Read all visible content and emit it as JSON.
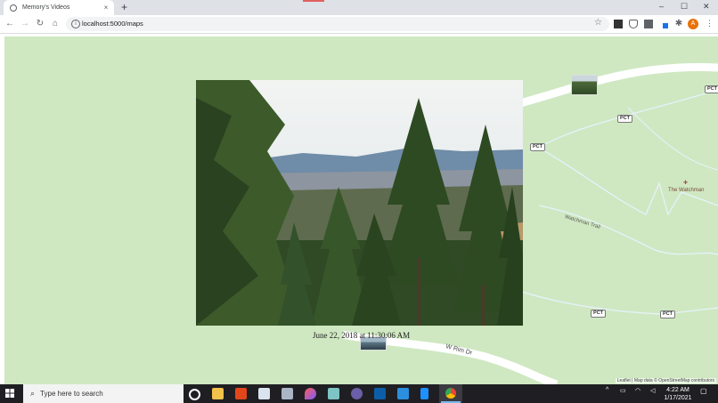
{
  "browser": {
    "tab_title": "Memory's Videos",
    "url": "localhost:5000/maps",
    "new_tab": "+",
    "tab_close": "×",
    "avatar_letter": "A",
    "minimize": "–",
    "maximize": "☐",
    "close": "✕"
  },
  "map": {
    "shields": [
      "PCT",
      "PCT",
      "PCT",
      "PCT",
      "PCT"
    ],
    "trail_label": "Watchman Trail",
    "road_label": "W Rim Dr",
    "poi_label": "The Watchman",
    "attribution": "Leaflet | Map data © OpenStreetMap contributors"
  },
  "video": {
    "caption": "June 22, 2018 at 11:30:06 AM"
  },
  "taskbar": {
    "search_placeholder": "Type here to search",
    "time": "4:22 AM",
    "date": "1/17/2021"
  },
  "colors": {
    "map_bg": "#cfe8c2",
    "road": "#ffffff",
    "tabstrip": "#dee1e6",
    "taskbar": "#1f1f23",
    "avatar": "#e8710a"
  }
}
